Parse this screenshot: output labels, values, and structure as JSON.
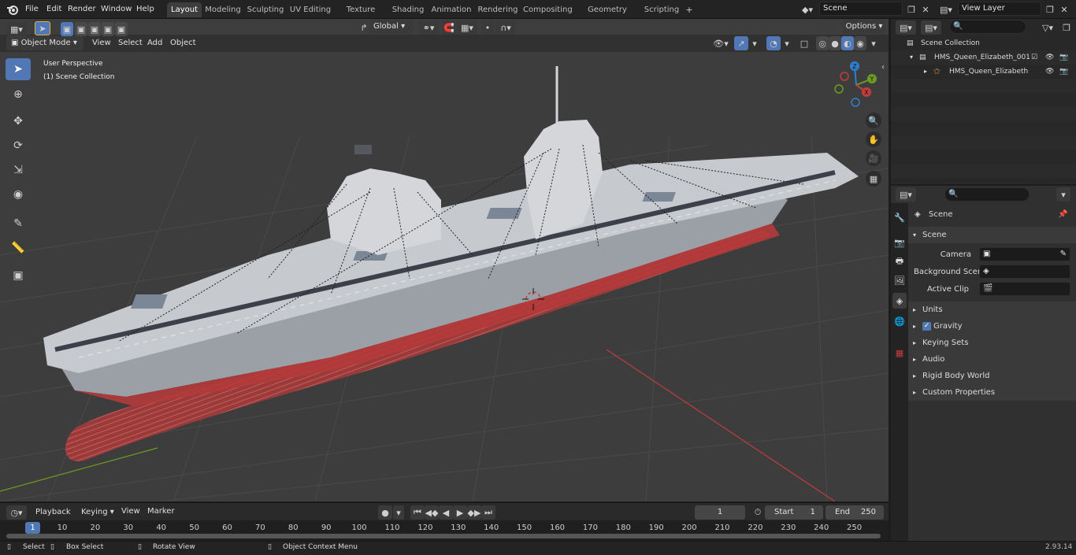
{
  "menu": {
    "file": "File",
    "edit": "Edit",
    "render": "Render",
    "window": "Window",
    "help": "Help"
  },
  "workspaces": [
    "Layout",
    "Modeling",
    "Sculpting",
    "UV Editing",
    "Texture Paint",
    "Shading",
    "Animation",
    "Rendering",
    "Compositing",
    "Geometry Nodes",
    "Scripting"
  ],
  "scene_field": "Scene",
  "view_layer_field": "View Layer",
  "viewport_header": {
    "mode": "Object Mode",
    "view": "View",
    "select": "Select",
    "add": "Add",
    "object": "Object",
    "orientation": "Global",
    "options": "Options"
  },
  "viewport_overlay": {
    "line1": "User Perspective",
    "line2": "(1) Scene Collection"
  },
  "gizmo": {
    "x": "X",
    "y": "Y",
    "z": "Z"
  },
  "outliner": {
    "root": "Scene Collection",
    "item1": "HMS_Queen_Elizabeth_001",
    "item2": "HMS_Queen_Elizabeth"
  },
  "properties": {
    "header": "Scene",
    "panel": "Scene",
    "camera_label": "Camera",
    "bg_label": "Background Scene",
    "clip_label": "Active Clip",
    "units": "Units",
    "gravity": "Gravity",
    "keying_sets": "Keying Sets",
    "audio": "Audio",
    "rigid_body": "Rigid Body World",
    "custom_props": "Custom Properties"
  },
  "timeline": {
    "playback": "Playback",
    "keying": "Keying",
    "view": "View",
    "marker": "Marker",
    "current_frame": "1",
    "start_label": "Start",
    "start_value": "1",
    "end_label": "End",
    "end_value": "250",
    "ticks": [
      "10",
      "20",
      "30",
      "40",
      "50",
      "60",
      "70",
      "80",
      "90",
      "100",
      "110",
      "120",
      "130",
      "140",
      "150",
      "160",
      "170",
      "180",
      "190",
      "200",
      "210",
      "220",
      "230",
      "240",
      "250"
    ],
    "playhead": "1"
  },
  "status": {
    "select": "Select",
    "box_select": "Box Select",
    "rotate_view": "Rotate View",
    "context_menu": "Object Context Menu",
    "version": "2.93.14"
  },
  "colors": {
    "accent": "#5178b5",
    "x_axis": "#c33d3d",
    "y_axis": "#6e9b22",
    "z_axis": "#2f7fd1",
    "hull_red": "#b33a3a"
  }
}
